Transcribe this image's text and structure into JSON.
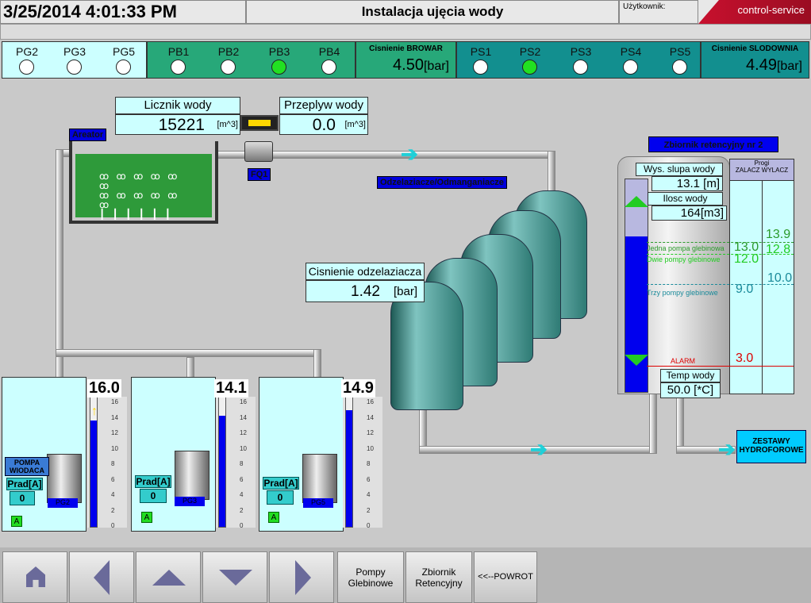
{
  "header": {
    "datetime": "3/25/2014 4:01:33 PM",
    "title": "Instalacja ujęcia wody",
    "user_label": "Użytkownik:",
    "brand": "control-service"
  },
  "status": {
    "pg": [
      {
        "label": "PG2",
        "on": false
      },
      {
        "label": "PG3",
        "on": false
      },
      {
        "label": "PG5",
        "on": false
      }
    ],
    "pb": [
      {
        "label": "PB1",
        "on": false
      },
      {
        "label": "PB2",
        "on": false
      },
      {
        "label": "PB3",
        "on": true
      },
      {
        "label": "PB4",
        "on": false
      }
    ],
    "browar": {
      "title": "Cisnienie BROWAR",
      "value": "4.50",
      "unit": "[bar]"
    },
    "ps": [
      {
        "label": "PS1",
        "on": false
      },
      {
        "label": "PS2",
        "on": true
      },
      {
        "label": "PS3",
        "on": false
      },
      {
        "label": "PS4",
        "on": false
      },
      {
        "label": "PS5",
        "on": false
      }
    ],
    "slodownia": {
      "title": "Cisnienie SLODOWNIA",
      "value": "4.49",
      "unit": "[bar]"
    }
  },
  "process": {
    "licznik": {
      "label": "Licznik wody",
      "value": "15221",
      "unit": "[m^3]"
    },
    "przeplyw": {
      "label": "Przeplyw wody",
      "value": "0.0",
      "unit": "[m^3]"
    },
    "areator": "Areator",
    "fq1": "FQ1",
    "odzel_tag": "Odzelaziacze/Odmanganiacze",
    "cisnienie_odz": {
      "label": "Cisnienie odzelaziacza",
      "value": "1.42",
      "unit": "[bar]"
    },
    "zestawy": "ZESTAWY HYDROFOROWE"
  },
  "tank": {
    "title": "Zbiornik retencyjny nr 2",
    "wys_label": "Wys. slupa wody",
    "wys_value": "13.1",
    "wys_unit": "[m]",
    "ilosc_label": "Ilosc wody",
    "ilosc_value": "164",
    "ilosc_unit": "[m3]",
    "progi_label": "Progi",
    "zalacz_wylacz": "ZALACZ WYLACZ",
    "level_fraction": 0.73,
    "thresholds": [
      {
        "label": "Jedna pompa glebinowa",
        "on": "13.0",
        "off": "13.9",
        "color": "#2a9a2a"
      },
      {
        "label": "Dwie pompy glebinowe",
        "on": "12.0",
        "off": "12.8",
        "color": "#22cc22"
      },
      {
        "label": "Trzy pompy glebinowe",
        "on": "9.0",
        "off": "10.0",
        "color": "#1a8a9a"
      },
      {
        "label": "ALARM",
        "on": "3.0",
        "off": "",
        "color": "#dd0000"
      }
    ],
    "temp_label": "Temp wody",
    "temp_value": "50.0",
    "temp_unit": "[*C]"
  },
  "wells": [
    {
      "name": "PG2",
      "level": "16.0",
      "fraction": 0.82,
      "prad_label": "Prad[A]",
      "prad": "0",
      "a": "A",
      "pompa": "POMPA WIODACA"
    },
    {
      "name": "PG3",
      "level": "14.1",
      "fraction": 0.86,
      "prad_label": "Prad[A]",
      "prad": "0",
      "a": "A",
      "pompa": ""
    },
    {
      "name": "PG5",
      "level": "14.9",
      "fraction": 0.9,
      "prad_label": "Prad[A]",
      "prad": "0",
      "a": "A",
      "pompa": ""
    }
  ],
  "gauge_ticks": [
    "16",
    "14",
    "12",
    "10",
    "8",
    "6",
    "4",
    "2",
    "0"
  ],
  "bottom": {
    "pompy": "Pompy Glebinowe",
    "zbiornik": "Zbiornik Retencyjny",
    "powrot": "<<--POWROT"
  }
}
